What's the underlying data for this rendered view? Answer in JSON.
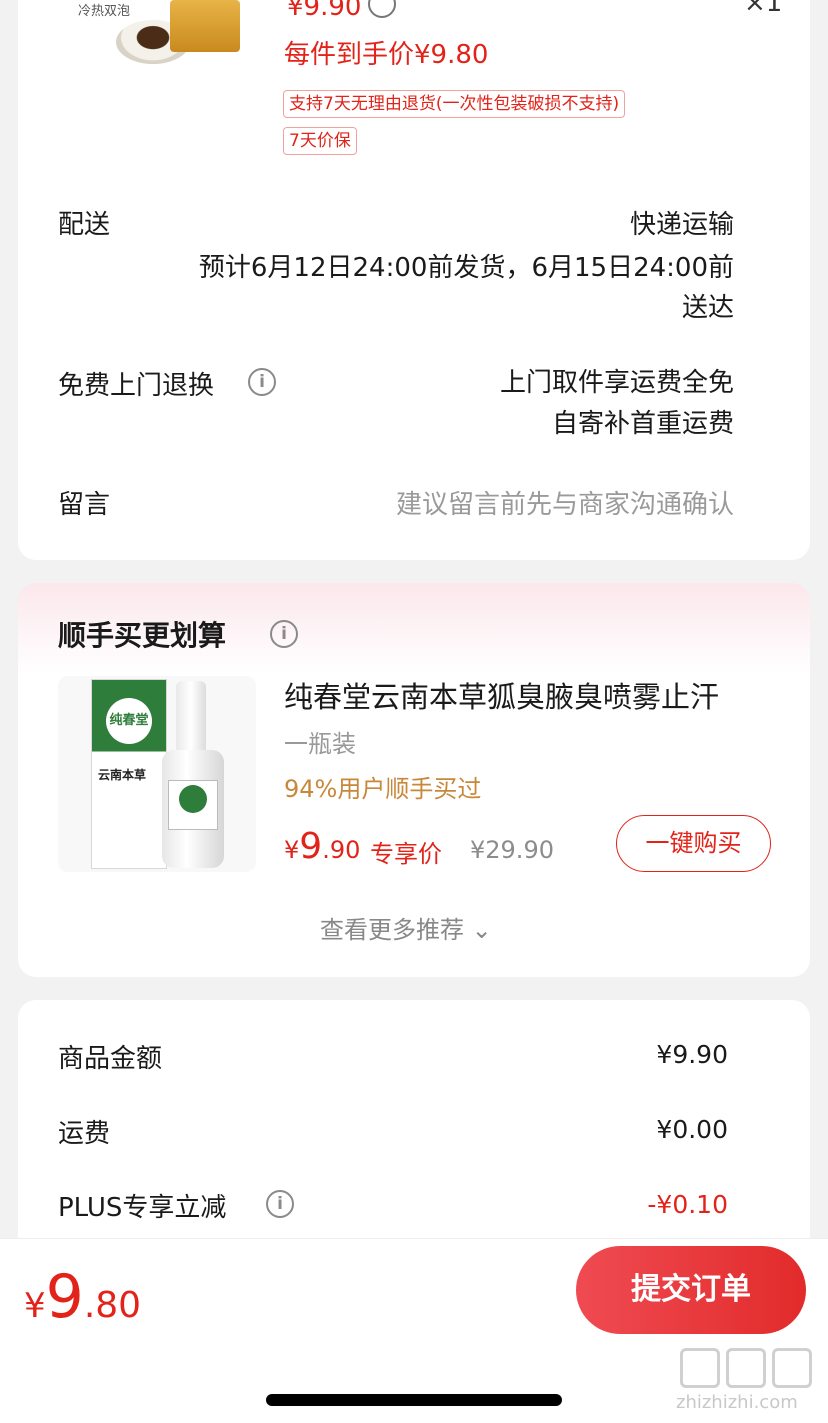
{
  "top_product": {
    "thumb_tag": "冷热双泡",
    "price": "¥9.90",
    "qty": "×1",
    "final_price": "每件到手价¥9.80",
    "tags": [
      "支持7天无理由退货(一次性包装破损不支持)",
      "7天价保"
    ]
  },
  "delivery": {
    "label": "配送",
    "method": "快递运输",
    "estimate_line1": "预计6月12日24:00前发货，6月15日24:00前",
    "estimate_line2": "送达"
  },
  "free_return": {
    "label": "免费上门退换",
    "line1": "上门取件享运费全免",
    "line2": "自寄补首重运费"
  },
  "message": {
    "label": "留言",
    "placeholder": "建议留言前先与商家沟通确认"
  },
  "recommend": {
    "title": "顺手买更划算",
    "product_name": "纯春堂云南本草狐臭腋臭喷雾止汗",
    "spec": "一瓶装",
    "bought": "94%用户顺手买过",
    "price_cur": "¥",
    "price_int": "9",
    "price_dec": ".90",
    "exclusive": "专享价",
    "orig_price": "¥29.90",
    "buy_label": "一键购买",
    "more_label": "查看更多推荐 ⌄",
    "image_text_seal": "纯春堂",
    "image_text_brand": "云南本草"
  },
  "summary": {
    "rows": [
      {
        "label": "商品金额",
        "value": "¥9.90"
      },
      {
        "label": "运费",
        "value": "¥0.00"
      },
      {
        "label": "PLUS专享立减",
        "value": "-¥0.10"
      }
    ]
  },
  "bottom": {
    "total_cur": "¥",
    "total_int": "9",
    "total_dec": ".80",
    "submit_label": "提交订单"
  },
  "watermark": {
    "text": "zhizhizhi.com"
  },
  "colors": {
    "accent_red": "#e2231a",
    "bought_orange": "#c8883a"
  }
}
